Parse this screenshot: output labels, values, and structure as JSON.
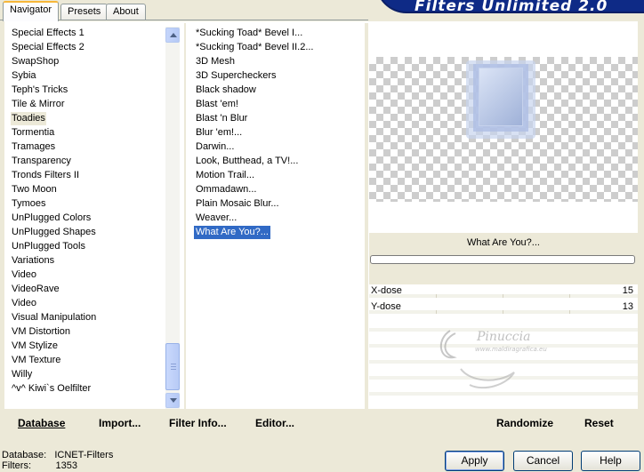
{
  "tabs": [
    {
      "label": "Navigator"
    },
    {
      "label": "Presets"
    },
    {
      "label": "About"
    }
  ],
  "header": {
    "title": "Filters Unlimited 2.0"
  },
  "categories": {
    "items": [
      "Special Effects 1",
      "Special Effects 2",
      "SwapShop",
      "Sybia",
      "Teph's Tricks",
      "Tile & Mirror",
      "Toadies",
      "Tormentia",
      "Tramages",
      "Transparency",
      "Tronds Filters II",
      "Two Moon",
      "Tymoes",
      "UnPlugged Colors",
      "UnPlugged Shapes",
      "UnPlugged Tools",
      "Variations",
      "Video",
      "VideoRave",
      "Video",
      "Visual Manipulation",
      "VM Distortion",
      "VM Stylize",
      "VM Texture",
      "Willy",
      "^v^ Kiwi`s Oelfilter"
    ],
    "selected": "Toadies"
  },
  "filters": {
    "items": [
      "*Sucking Toad*  Bevel I...",
      "*Sucking Toad*  Bevel II.2...",
      "3D Mesh",
      "3D Supercheckers",
      "Black shadow",
      "Blast 'em!",
      "Blast 'n Blur",
      "Blur 'em!...",
      "Darwin...",
      "Look, Butthead, a TV!...",
      "Motion Trail...",
      "Ommadawn...",
      "Plain Mosaic Blur...",
      "Weaver...",
      "What Are You?..."
    ],
    "selected": "What Are You?..."
  },
  "preview": {
    "filter_name": "What Are You?..."
  },
  "params": [
    {
      "label": "X-dose",
      "value": "15",
      "fraction": 0.059
    },
    {
      "label": "Y-dose",
      "value": "13",
      "fraction": 0.051
    }
  ],
  "toolbar": {
    "database": "Database",
    "import": "Import...",
    "filter_info": "Filter Info...",
    "editor": "Editor...",
    "randomize": "Randomize",
    "reset": "Reset"
  },
  "status": {
    "database_label": "Database:",
    "database_value": "ICNET-Filters",
    "filters_label": "Filters:",
    "filters_value": "1353"
  },
  "buttons": {
    "apply": "Apply",
    "cancel": "Cancel",
    "help": "Help"
  },
  "watermark": {
    "text": "Pinuccia",
    "url": "www.maldiragrafica.eu"
  }
}
